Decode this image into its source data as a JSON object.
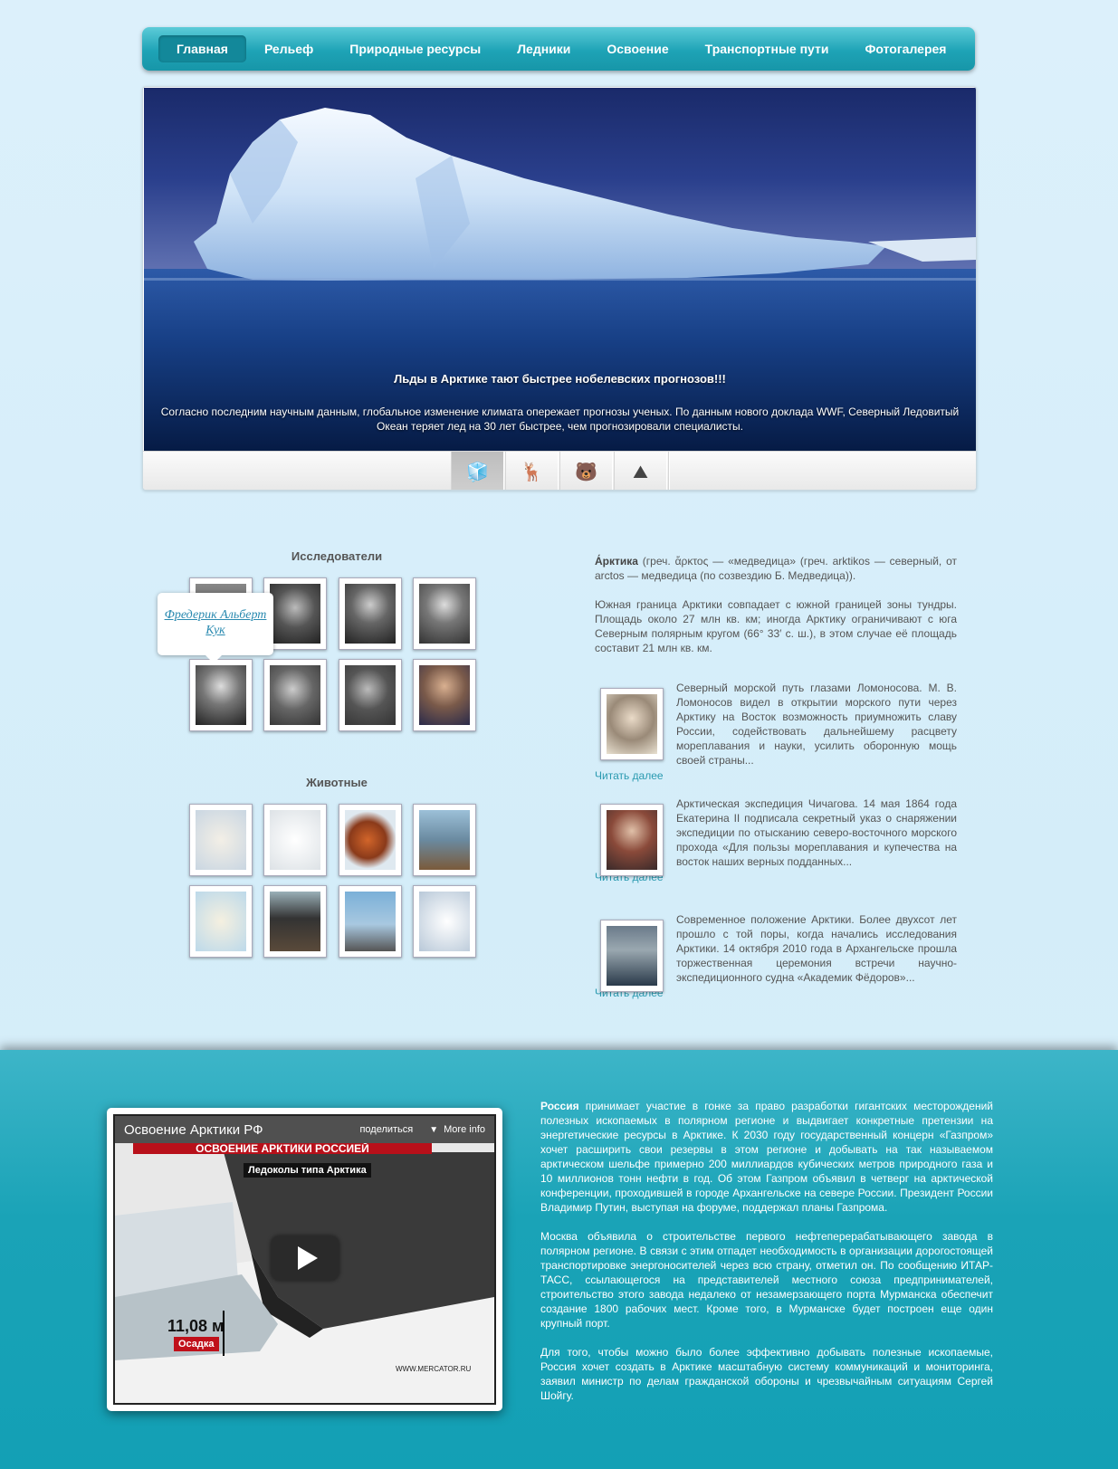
{
  "nav": {
    "items": [
      "Главная",
      "Рельеф",
      "Природные ресурсы",
      "Ледники",
      "Освоение",
      "Транспортные пути",
      "Фотогалерея"
    ],
    "active_index": 0
  },
  "slider": {
    "title": "Льды в Арктике тают быстрее нобелевских прогнозов!!!",
    "text": "Согласно последним научным данным, глобальное изменение климата опережает прогнозы ученых. По данным нового доклада WWF, Северный Ледовитый Океан теряет лед на 30 лет быстрее, чем прогнозировали специалисты.",
    "thumbs": [
      {
        "icon": "ice-cube-icon",
        "glyph": "🧊",
        "active": true
      },
      {
        "icon": "deer-icon",
        "glyph": "🦌",
        "active": false
      },
      {
        "icon": "polar-bear-icon",
        "glyph": "🐻",
        "active": false
      },
      {
        "icon": "iceberg-icon",
        "glyph": "⛰",
        "active": false
      }
    ]
  },
  "explorers": {
    "title": "Исследователи",
    "tooltip": "Фредерик Альберт Кук"
  },
  "animals": {
    "title": "Животные"
  },
  "intro": {
    "lead_bold": "А́рктика",
    "lead_rest": " (греч. ἄρκτος — «медведица» (греч. arktikos — северный, от arctos — медведица (по созвездию Б. Медведица)).",
    "p2": "Южная граница Арктики совпадает с южной границей зоны тундры. Площадь около 27 млн кв. км; иногда Арктику ограничивают с юга Северным полярным кругом (66° 33′ с. ш.), в этом случае её площадь составит 21 млн кв. км."
  },
  "articles": [
    {
      "text": "Северный морской путь глазами Ломоносова. М. В. Ломоносов видел в открытии морского пути через Арктику на Восток возможность приумножить славу России, содействовать дальнейшему расцвету мореплавания и науки, усилить оборонную мощь своей страны...",
      "more": "Читать далее"
    },
    {
      "text": "Арктическая экспедиция Чичагова. 14 мая 1864 года Екатерина II подписала секретный указ о снаряжении экспедиции по отысканию северо-восточного морского прохода «Для пользы мореплавания и купечества на восток наших верных подданных...",
      "more": "Читать далее"
    },
    {
      "text": "Современное положение Арктики. Более двухсот лет прошло с той поры, когда начались исследования Арктики. 14 октября 2010 года в Архангельске прошла торжественная церемония встречи научно-экспедиционного судна «Академик Фёдоров»...",
      "more": "Читать далее"
    }
  ],
  "video": {
    "title": "Освоение Арктики РФ",
    "share": "поделиться",
    "more_info": "More info",
    "banner": "ОСВОЕНИЕ АРКТИКИ РОССИЕЙ",
    "subbanner": "Ледоколы типа Арктика",
    "depth": "11,08 м",
    "osadka": "Осадка",
    "site": "WWW.MERCATOR.RU"
  },
  "bottom": {
    "p1_bold": "Россия",
    "p1_rest": " принимает участие в гонке за право разработки гигантских месторождений полезных ископаемых в полярном регионе и выдвигает конкретные претензии на энергетические ресурсы в Арктике. К 2030 году государственный концерн «Газпром» хочет расширить свои резервы в этом регионе и добывать на так называемом арктическом шельфе примерно 200 миллиардов кубических метров природного газа и 10 миллионов тонн нефти в год. Об этом Газпром объявил в четверг на арктической конференции, проходившей в городе Архангельске на севере России. Президент России Владимир Путин, выступая на форуме, поддержал планы Газпрома.",
    "p2": "Москва объявила о строительстве первого нефтеперерабатывающего завода в полярном регионе. В связи с этим отпадет необходимость в организации дорогостоящей транспортировке энергоносителей через всю страну, отметил он. По сообщению ИТАР-ТАСС, ссылающегося на представителей местного союза предпринимателей, строительство этого завода недалеко от незамерзающего порта Мурманска обеспечит создание 1800 рабочих мест. Кроме того, в Мурманске будет построен еще один крупный порт.",
    "p3": "Для того, чтобы можно было более эффективно добывать полезные ископаемые, Россия хочет создать в Арктике масштабную систему коммуникаций и мониторинга, заявил министр по делам гражданской обороны и чрезвычайным ситуациям Сергей Шойгу."
  }
}
